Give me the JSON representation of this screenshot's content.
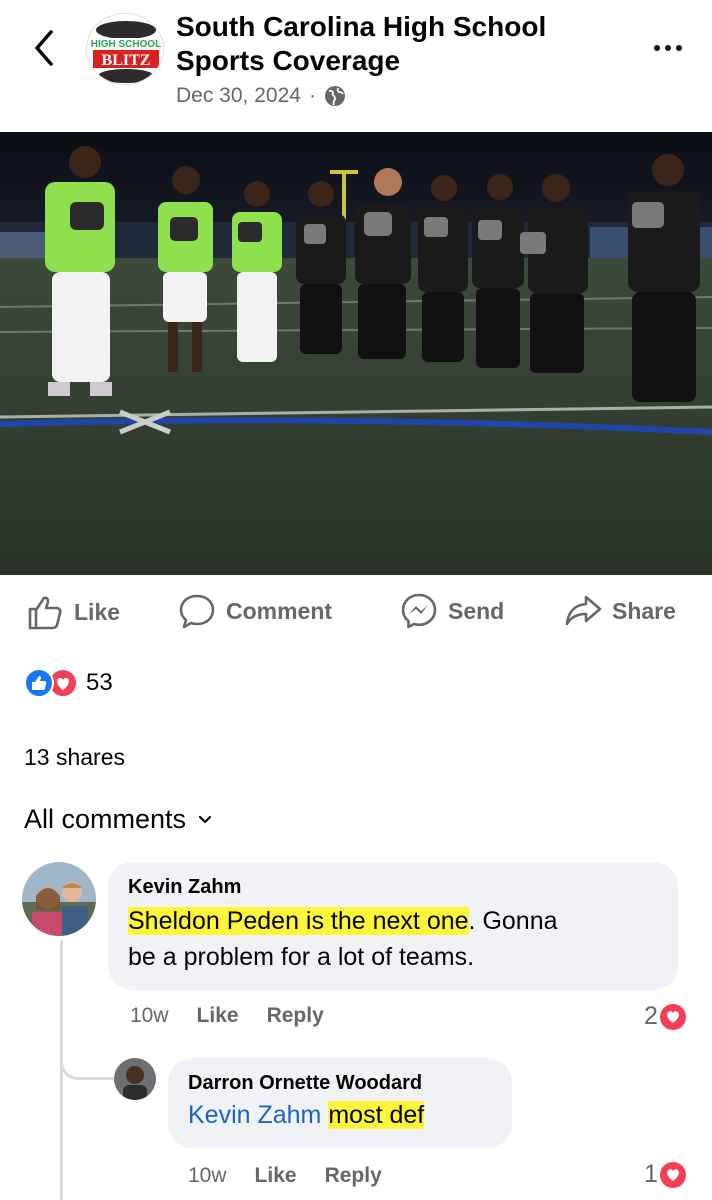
{
  "header": {
    "page_name": "South Carolina High School Sports Coverage",
    "date": "Dec 30, 2024",
    "separator": "·",
    "logo_text_top": "HIGH SCHOOL",
    "logo_text_bottom": "BLITZ"
  },
  "actions": {
    "like": "Like",
    "comment": "Comment",
    "send": "Send",
    "share": "Share"
  },
  "stats": {
    "reaction_count": "53",
    "shares": "13 shares"
  },
  "comments_header": "All comments",
  "comments": [
    {
      "author": "Kevin Zahm",
      "text_highlighted": "Sheldon Peden is the next one",
      "text_line1_rest": ". Gonna",
      "text_line2": "be a problem for a lot of teams.",
      "time": "10w",
      "like": "Like",
      "reply": "Reply",
      "reactions": "2"
    },
    {
      "author": "Darron Ornette Woodard",
      "mention": "Kevin Zahm",
      "text_highlighted": "most def",
      "time": "10w",
      "like": "Like",
      "reply": "Reply",
      "reactions": "1"
    }
  ],
  "colors": {
    "secondary_text": "#65676b",
    "comment_bubble": "#f0f2f5",
    "highlight": "#fcf53a",
    "mention": "#1d65c1",
    "like_blue": "#1877f2",
    "love_red": "#f33e58"
  }
}
